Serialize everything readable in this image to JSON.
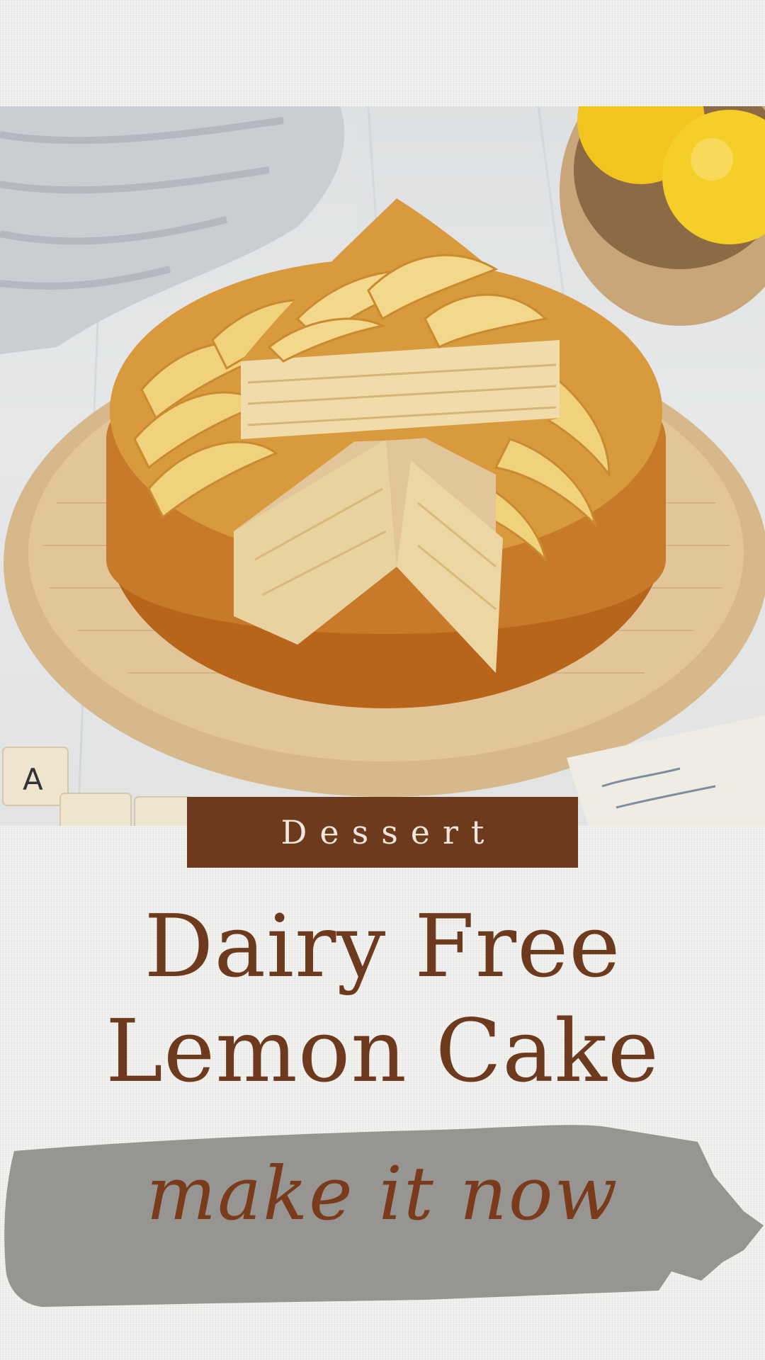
{
  "category": "Dessert",
  "title": {
    "line1": "Dairy Free",
    "line2": "Lemon Cake"
  },
  "cta": {
    "label": "make it now"
  },
  "colors": {
    "brand_brown": "#6e3a1e",
    "banner_text": "#f1e6dc",
    "brush_gray": "#969592",
    "background": "#ededeb"
  },
  "image": {
    "subject": "apple-topped lemon cake on round wooden board with lemons in bowl"
  }
}
